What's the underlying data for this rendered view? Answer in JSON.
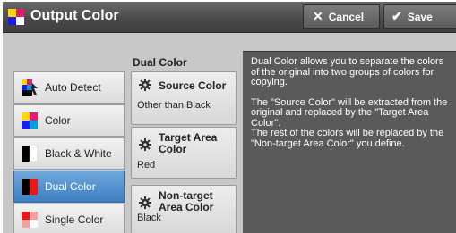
{
  "header": {
    "title": "Output Color",
    "cancel_label": "Cancel",
    "save_label": "Save"
  },
  "left_menu": {
    "items": [
      {
        "label": "Auto Detect",
        "icon": "auto-detect-color-icon"
      },
      {
        "label": "Color",
        "icon": "color-squares-icon"
      },
      {
        "label": "Black & White",
        "icon": "black-white-icon"
      },
      {
        "label": "Dual Color",
        "icon": "dual-color-icon",
        "selected": true
      },
      {
        "label": "Single Color",
        "icon": "single-color-icon"
      }
    ]
  },
  "dual_color": {
    "heading": "Dual Color",
    "options": [
      {
        "title": "Source Color",
        "value": "Other than Black"
      },
      {
        "title": "Target Area Color",
        "value": "Red"
      },
      {
        "title": "Non-target Area Color",
        "value": "Black"
      }
    ]
  },
  "info": {
    "para1": "Dual Color allows you to separate the colors of the original into two groups of colors for copying.",
    "para2a": "The \"Source Color\" will be extracted from the original and replaced by the \"Target Area Color\".",
    "para2b": "The rest of the colors will be replaced by the \"Non-target Area Color\" you define."
  },
  "colors": {
    "selected_item": "#4a8ccc",
    "title_bar": "#4f4f4f",
    "info_panel": "#5a5a5a"
  }
}
